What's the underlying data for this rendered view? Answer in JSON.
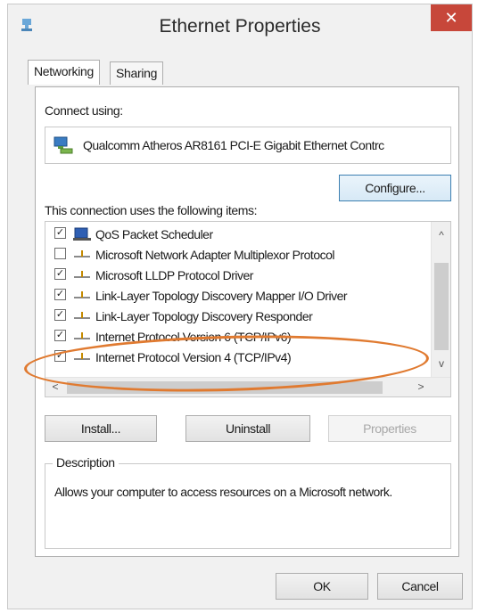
{
  "window": {
    "title": "Ethernet Properties",
    "close_glyph": "✕"
  },
  "tabs": [
    {
      "label": "Networking",
      "active": true
    },
    {
      "label": "Sharing",
      "active": false
    }
  ],
  "connect_using": {
    "label": "Connect using:",
    "adapter_name": "Qualcomm Atheros AR8161 PCI-E Gigabit Ethernet Contrc",
    "adapter_icon": "network-adapter-icon"
  },
  "buttons": {
    "configure": "Configure...",
    "install": "Install...",
    "uninstall": "Uninstall",
    "properties": "Properties",
    "ok": "OK",
    "cancel": "Cancel"
  },
  "items_label": "This connection uses the following items:",
  "items": [
    {
      "label": "QoS Packet Scheduler",
      "checked": true,
      "icon": "qos-scheduler-icon"
    },
    {
      "label": "Microsoft Network Adapter Multiplexor Protocol",
      "checked": false,
      "icon": "protocol-icon"
    },
    {
      "label": "Microsoft LLDP Protocol Driver",
      "checked": true,
      "icon": "protocol-icon"
    },
    {
      "label": "Link-Layer Topology Discovery Mapper I/O Driver",
      "checked": true,
      "icon": "protocol-icon"
    },
    {
      "label": "Link-Layer Topology Discovery Responder",
      "checked": true,
      "icon": "protocol-icon"
    },
    {
      "label": "Internet Protocol Version 6 (TCP/IPv6)",
      "checked": true,
      "icon": "protocol-icon"
    },
    {
      "label": "Internet Protocol Version 4 (TCP/IPv4)",
      "checked": true,
      "icon": "protocol-icon"
    }
  ],
  "scroll": {
    "up": "^",
    "down": "v",
    "left": "<",
    "right": ">"
  },
  "description": {
    "title": "Description",
    "text": "Allows your computer to access resources on a Microsoft network."
  },
  "colors": {
    "highlight": "#e07a30",
    "close": "#c7473a"
  }
}
